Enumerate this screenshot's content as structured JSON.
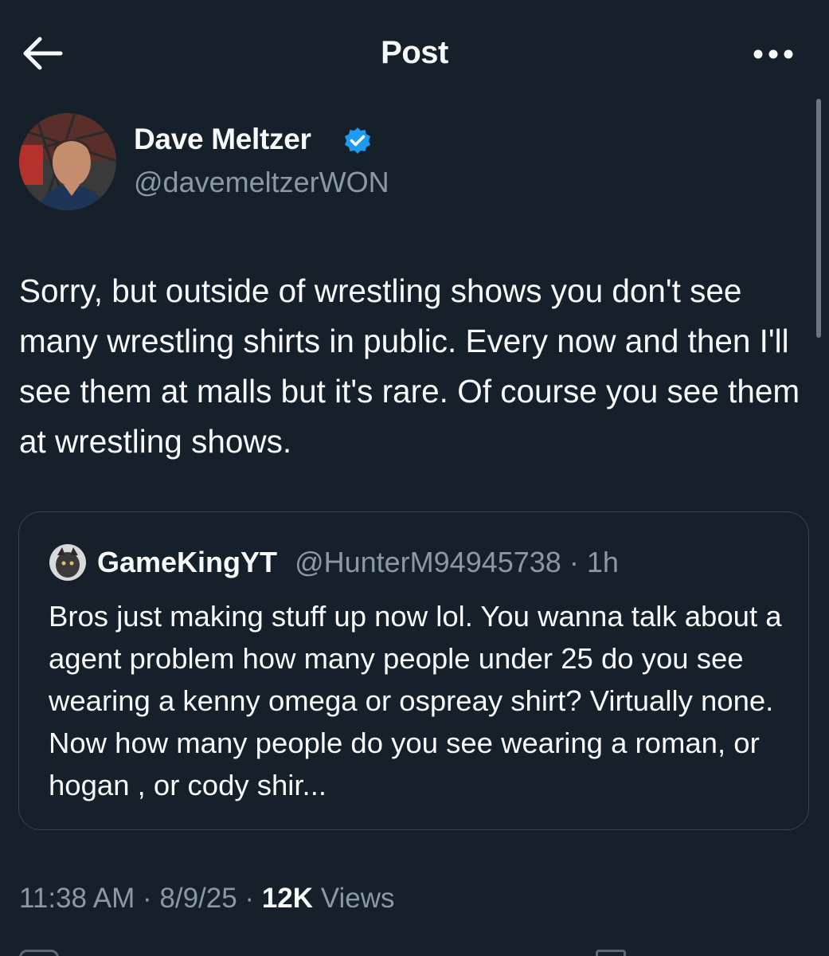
{
  "header": {
    "title": "Post",
    "back_icon": "arrow-left-icon",
    "more_icon": "more-horizontal-icon"
  },
  "author": {
    "name": "Dave Meltzer",
    "handle": "@davemeltzerWON",
    "verified": true,
    "verified_color": "#1d9bf0"
  },
  "post": {
    "text": "Sorry, but outside of wrestling shows you don't see many wrestling shirts in public.  Every now and then I'll see them at malls but it's rare.  Of course you see them at wrestling shows."
  },
  "quote": {
    "name": "GameKingYT",
    "handle": "@HunterM94945738",
    "separator": " · ",
    "time": "1h",
    "text": "Bros just making stuff up now lol. You wanna talk about a agent problem how many people under 25 do you see wearing a kenny omega or ospreay shirt? Virtually none. Now how many people do you see wearing a roman, or hogan , or cody shir..."
  },
  "meta": {
    "time": "11:38 AM",
    "sep1": " · ",
    "date": "8/9/25",
    "sep2": " · ",
    "views_count": "12K",
    "views_label": " Views"
  },
  "colors": {
    "background": "#15202b",
    "text": "#f7f9f9",
    "secondary_text": "#8b98a5",
    "border": "#38444d",
    "accent": "#1d9bf0"
  }
}
